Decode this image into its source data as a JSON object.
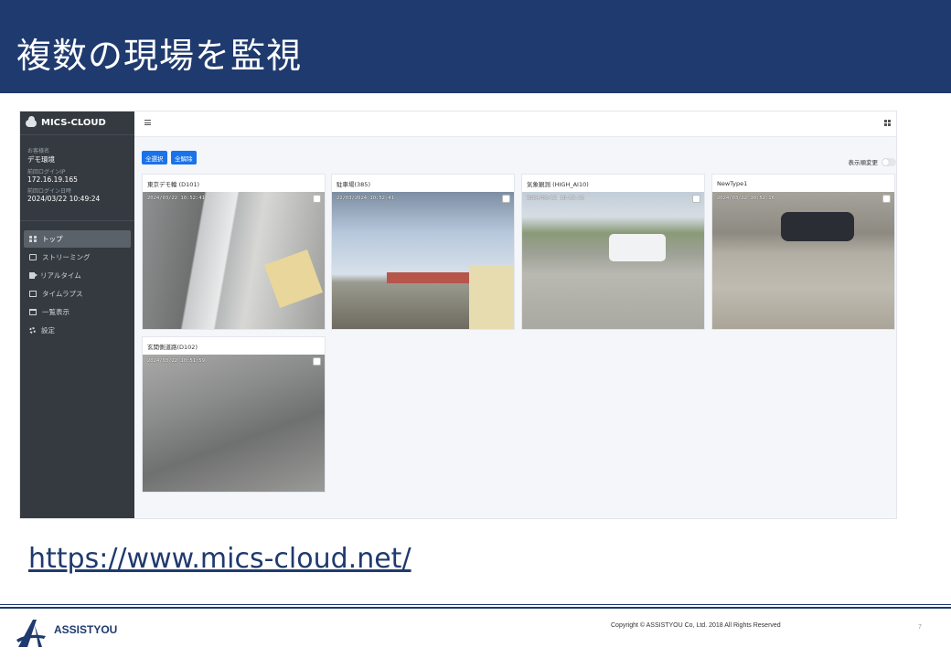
{
  "slide": {
    "title": "複数の現場を監視",
    "url": "https://www.mics-cloud.net/",
    "company": "ASSISTYOU",
    "copyright": "Copyright © ASSISTYOU Co, Ltd. 2018 All Rights Reserved",
    "page_number": "7",
    "brand_color": "#1f3a6e"
  },
  "app": {
    "brand": "MICS-CLOUD",
    "info": {
      "customer_label": "お客様名",
      "customer_value": "デモ環境",
      "last_ip_label": "前回ログインIP",
      "last_ip_value": "172.16.19.165",
      "last_login_label": "前回ログイン日時",
      "last_login_value": "2024/03/22 10:49:24"
    },
    "nav": [
      {
        "label": "トップ",
        "icon": "grid-icon",
        "active": true
      },
      {
        "label": "ストリーミング",
        "icon": "monitor-icon",
        "active": false
      },
      {
        "label": "リアルタイム",
        "icon": "video-icon",
        "active": false
      },
      {
        "label": "タイムラプス",
        "icon": "film-icon",
        "active": false
      },
      {
        "label": "一覧表示",
        "icon": "window-icon",
        "active": false
      },
      {
        "label": "設定",
        "icon": "gear-icon",
        "active": false
      }
    ],
    "buttons": {
      "select_all": "全選択",
      "clear_all": "全解除"
    },
    "sort_label": "表示順変更",
    "cameras": [
      {
        "name": "東京デモ輪 (D101)",
        "timestamp": "2024/03/22 10:52:41"
      },
      {
        "name": "駐車場(385)",
        "timestamp": "22/03/2024 10:52:41"
      },
      {
        "name": "気象観測 (HIGH_AI10)",
        "timestamp": "2024/03/22 10:52:16"
      },
      {
        "name": "NewType1",
        "timestamp": "2024/03/22 10:52:16"
      },
      {
        "name": "玄関側道路(D102)",
        "timestamp": "2024/03/22 10:51:59"
      }
    ],
    "accent_color": "#1a73e8",
    "sidebar_color": "#343a40"
  }
}
